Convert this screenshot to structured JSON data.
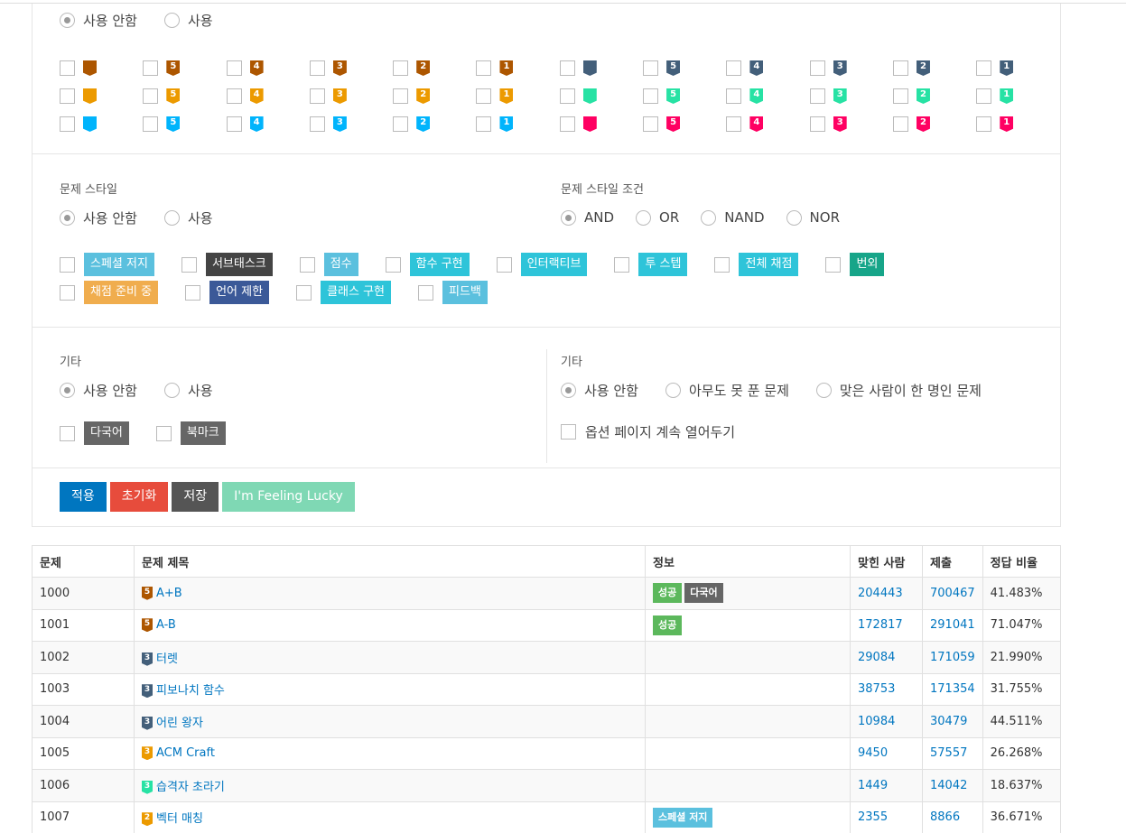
{
  "tier_filter": {
    "options": [
      "사용 안함",
      "사용"
    ],
    "rows": [
      [
        {
          "c": "#ad5600",
          "n": ""
        },
        {
          "c": "#ad5600",
          "n": "5"
        },
        {
          "c": "#ad5600",
          "n": "4"
        },
        {
          "c": "#ad5600",
          "n": "3"
        },
        {
          "c": "#ad5600",
          "n": "2"
        },
        {
          "c": "#ad5600",
          "n": "1"
        },
        {
          "c": "#435f7a",
          "n": ""
        },
        {
          "c": "#435f7a",
          "n": "5"
        },
        {
          "c": "#435f7a",
          "n": "4"
        },
        {
          "c": "#435f7a",
          "n": "3"
        },
        {
          "c": "#435f7a",
          "n": "2"
        },
        {
          "c": "#435f7a",
          "n": "1"
        }
      ],
      [
        {
          "c": "#ec9a00",
          "n": ""
        },
        {
          "c": "#ec9a00",
          "n": "5"
        },
        {
          "c": "#ec9a00",
          "n": "4"
        },
        {
          "c": "#ec9a00",
          "n": "3"
        },
        {
          "c": "#ec9a00",
          "n": "2"
        },
        {
          "c": "#ec9a00",
          "n": "1"
        },
        {
          "c": "#27e2a4",
          "n": ""
        },
        {
          "c": "#27e2a4",
          "n": "5"
        },
        {
          "c": "#27e2a4",
          "n": "4"
        },
        {
          "c": "#27e2a4",
          "n": "3"
        },
        {
          "c": "#27e2a4",
          "n": "2"
        },
        {
          "c": "#27e2a4",
          "n": "1"
        }
      ],
      [
        {
          "c": "#00b4fc",
          "n": ""
        },
        {
          "c": "#00b4fc",
          "n": "5"
        },
        {
          "c": "#00b4fc",
          "n": "4"
        },
        {
          "c": "#00b4fc",
          "n": "3"
        },
        {
          "c": "#00b4fc",
          "n": "2"
        },
        {
          "c": "#00b4fc",
          "n": "1"
        },
        {
          "c": "#ff0062",
          "n": ""
        },
        {
          "c": "#ff0062",
          "n": "5"
        },
        {
          "c": "#ff0062",
          "n": "4"
        },
        {
          "c": "#ff0062",
          "n": "3"
        },
        {
          "c": "#ff0062",
          "n": "2"
        },
        {
          "c": "#ff0062",
          "n": "1"
        }
      ]
    ]
  },
  "style_section": {
    "label": "문제 스타일",
    "options": [
      "사용 안함",
      "사용"
    ],
    "condition_label": "문제 스타일 조건",
    "conditions": [
      "AND",
      "OR",
      "NAND",
      "NOR"
    ],
    "tags_row1": [
      {
        "text": "스페셜 저지",
        "color": "#5bc0de"
      },
      {
        "text": "서브태스크",
        "color": "#444444"
      },
      {
        "text": "점수",
        "color": "#5bc0de"
      },
      {
        "text": "함수 구현",
        "color": "#2ec4d9"
      },
      {
        "text": "인터랙티브",
        "color": "#2ec4d9"
      },
      {
        "text": "투 스텝",
        "color": "#2ec4d9"
      },
      {
        "text": "전체 채점",
        "color": "#2ec4d9"
      },
      {
        "text": "번외",
        "color": "#17a589"
      }
    ],
    "tags_row2": [
      {
        "text": "채점 준비 중",
        "color": "#f0ad4e"
      },
      {
        "text": "언어 제한",
        "color": "#3b5998"
      },
      {
        "text": "클래스 구현",
        "color": "#2ec4d9"
      },
      {
        "text": "피드백",
        "color": "#5bc0de"
      }
    ]
  },
  "etc_section": {
    "label": "기타",
    "options": [
      "사용 안함",
      "사용"
    ],
    "tags": [
      {
        "text": "다국어",
        "color": "#666666"
      },
      {
        "text": "북마크",
        "color": "#666666"
      }
    ],
    "label2": "기타",
    "options2": [
      "사용 안함",
      "아무도 못 푼 문제",
      "맞은 사람이 한 명인 문제"
    ],
    "keep_open": "옵션 페이지 계속 열어두기"
  },
  "buttons": [
    {
      "label": "적용",
      "color": "#0076c0"
    },
    {
      "label": "초기화",
      "color": "#e74c3c"
    },
    {
      "label": "저장",
      "color": "#555555"
    },
    {
      "label": "I'm Feeling Lucky",
      "color": "#7fd8b4"
    }
  ],
  "table": {
    "headers": [
      "문제",
      "문제 제목",
      "정보",
      "맞힌 사람",
      "제출",
      "정답 비율"
    ],
    "rows": [
      {
        "id": "1000",
        "tier": "5",
        "tc": "#ad5600",
        "title": "A+B",
        "tags": [
          {
            "t": "성공",
            "c": "#5cb85c"
          },
          {
            "t": "다국어",
            "c": "#666666"
          }
        ],
        "solved": "204443",
        "submit": "700467",
        "ratio": "41.483%"
      },
      {
        "id": "1001",
        "tier": "5",
        "tc": "#ad5600",
        "title": "A-B",
        "tags": [
          {
            "t": "성공",
            "c": "#5cb85c"
          }
        ],
        "solved": "172817",
        "submit": "291041",
        "ratio": "71.047%"
      },
      {
        "id": "1002",
        "tier": "3",
        "tc": "#435f7a",
        "title": "터렛",
        "tags": [],
        "solved": "29084",
        "submit": "171059",
        "ratio": "21.990%"
      },
      {
        "id": "1003",
        "tier": "3",
        "tc": "#435f7a",
        "title": "피보나치 함수",
        "tags": [],
        "solved": "38753",
        "submit": "171354",
        "ratio": "31.755%"
      },
      {
        "id": "1004",
        "tier": "3",
        "tc": "#435f7a",
        "title": "어린 왕자",
        "tags": [],
        "solved": "10984",
        "submit": "30479",
        "ratio": "44.511%"
      },
      {
        "id": "1005",
        "tier": "3",
        "tc": "#ec9a00",
        "title": "ACM Craft",
        "tags": [],
        "solved": "9450",
        "submit": "57557",
        "ratio": "26.268%"
      },
      {
        "id": "1006",
        "tier": "3",
        "tc": "#27e2a4",
        "title": "습격자 초라기",
        "tags": [],
        "solved": "1449",
        "submit": "14042",
        "ratio": "18.637%"
      },
      {
        "id": "1007",
        "tier": "2",
        "tc": "#ec9a00",
        "title": "벡터 매칭",
        "tags": [
          {
            "t": "스페셜 저지",
            "c": "#5bc0de"
          }
        ],
        "solved": "2355",
        "submit": "8866",
        "ratio": "36.671%"
      }
    ]
  }
}
